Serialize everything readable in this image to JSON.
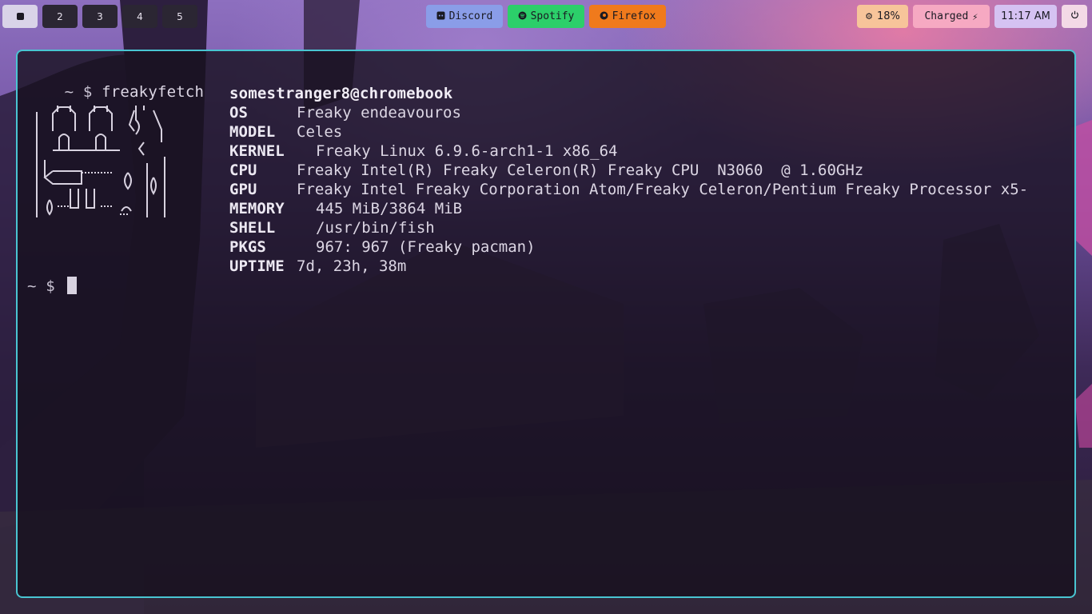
{
  "workspaces": [
    {
      "label": "",
      "active": true
    },
    {
      "label": "2",
      "active": false
    },
    {
      "label": "3",
      "active": false
    },
    {
      "label": "4",
      "active": false
    },
    {
      "label": "5",
      "active": false
    }
  ],
  "apps": {
    "discord": {
      "label": "Discord",
      "icon": "discord-icon",
      "color": "#8a9de8"
    },
    "spotify": {
      "label": "Spotify",
      "icon": "spotify-icon",
      "color": "#2ccf6a"
    },
    "firefox": {
      "label": "Firefox",
      "icon": "firefox-icon",
      "color": "#f07a1c"
    }
  },
  "status": {
    "cpu": {
      "label": "18%",
      "icon": "cpu-icon",
      "color": "#f7c49a"
    },
    "battery": {
      "label": "Charged",
      "icon": "bolt-icon",
      "color": "#f6a9c2"
    },
    "clock": {
      "label": "11:17 AM",
      "color": "#d5c2f2"
    },
    "power": {
      "icon": "power-icon",
      "color": "#f3d9e6"
    }
  },
  "terminal": {
    "prompt": "~ $",
    "command": "freakyfetch",
    "userhost": "somestranger8@chromebook",
    "info": [
      {
        "key": "OS",
        "value": "Freaky endeavouros"
      },
      {
        "key": "MODEL",
        "value": "Celes"
      },
      {
        "key": "KERNEL",
        "value": "Freaky Linux 6.9.6-arch1-1 x86_64"
      },
      {
        "key": "CPU",
        "value": "Freaky Intel(R) Freaky Celeron(R) Freaky CPU  N3060  @ 1.60GHz"
      },
      {
        "key": "GPU",
        "value": "Freaky Intel Freaky Corporation Atom/Freaky Celeron/Pentium Freaky Processor x5-"
      },
      {
        "key": "MEMORY",
        "value": "445 MiB/3864 MiB"
      },
      {
        "key": "SHELL",
        "value": "/usr/bin/fish"
      },
      {
        "key": "PKGS",
        "value": "967: 967 (Freaky pacman)"
      },
      {
        "key": "UPTIME",
        "value": "7d, 23h, 38m"
      }
    ],
    "prompt2": "~ $"
  },
  "colors": {
    "terminal_border": "#49c5d2"
  }
}
